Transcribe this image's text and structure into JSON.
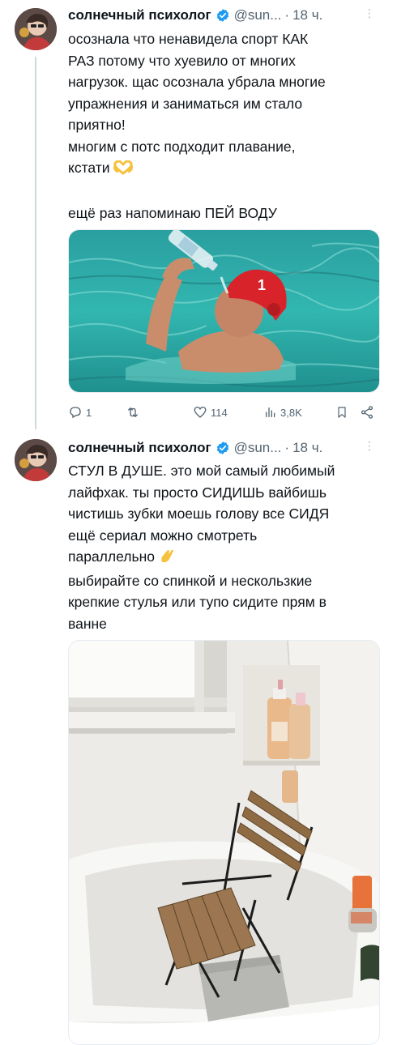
{
  "tweets": [
    {
      "author_name": "солнечный психолог",
      "handle": "@sun...",
      "separator": "·",
      "time": "18 ч.",
      "lines": [
        "осознала что ненавидела спорт КАК",
        "РАЗ потому что хуевило от многих",
        "нагрузок. щас осознала убрала многие",
        "упражнения и заниматься им стало",
        "приятно!",
        "многим с потс подходит плавание,",
        "кстати",
        "",
        "ещё раз напоминаю ПЕЙ ВОДУ"
      ],
      "inline_emoji": "heart-hands",
      "media": "water-polo-player-pouring-water-photo",
      "actions": {
        "replies": "1",
        "reposts": "",
        "likes": "114",
        "views": "3,8K"
      }
    },
    {
      "author_name": "солнечный психолог",
      "handle": "@sun...",
      "separator": "·",
      "time": "18 ч.",
      "lines": [
        "СТУЛ В ДУШЕ. это мой самый любимый",
        "лайфхак. ты просто СИДИШЬ вайбишь",
        "чистишь зубки моешь голову все СИДЯ",
        "ещё сериал можно смотреть",
        "параллельно",
        "выбирайте со спинкой и нескользкие",
        "крепкие стулья или тупо сидите прям в",
        "ванне"
      ],
      "inline_emoji": "pinching-hand",
      "media": "folding-chair-in-bathtub-photo"
    }
  ],
  "colors": {
    "text": "#0f1419",
    "secondary": "#536471",
    "verified": "#1d9bf0",
    "pool_water": "#2aa9a0",
    "cap_red": "#d8232a"
  }
}
